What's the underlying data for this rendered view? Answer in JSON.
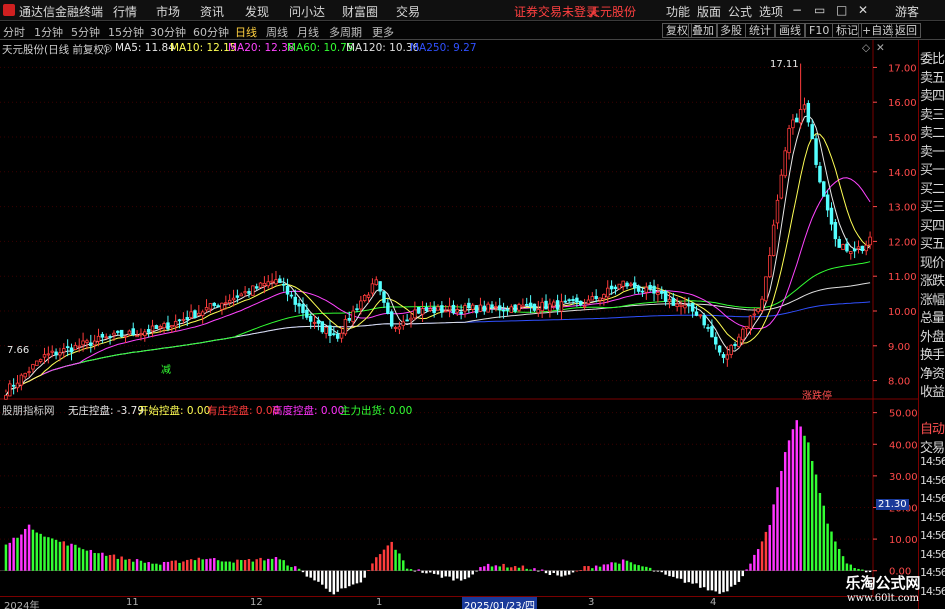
{
  "menubar": {
    "app_title": "通达信金融终端",
    "items": [
      "行情",
      "市场",
      "资讯",
      "发现",
      "问小达",
      "财富圈",
      "交易"
    ],
    "status": "证券交易未登录",
    "stock": "天元股份",
    "right_items": [
      "功能",
      "版面",
      "公式",
      "选项"
    ],
    "guest": "游客"
  },
  "periodbar": {
    "periods": [
      "分时",
      "1分钟",
      "5分钟",
      "15分钟",
      "30分钟",
      "60分钟",
      "日线",
      "周线",
      "月线",
      "多周期",
      "更多"
    ],
    "active": "日线",
    "tools": [
      "复权",
      "叠加",
      "多股",
      "统计",
      "画线",
      "F10",
      "标记",
      "+自选",
      "返回"
    ]
  },
  "main_legend": {
    "title": "天元股份(日线 前复权)",
    "ma5": "MA5: 11.84",
    "ma10": "MA10: 12.15",
    "ma20": "MA20: 12.38",
    "ma60": "MA60: 10.75",
    "ma120": "MA120: 10.36",
    "ma250": "MA250: 9.27"
  },
  "sub_legend": {
    "title": "股朋指标网",
    "wzkp": "无庄控盘: -3.79",
    "kskp": "开始控盘: 0.00",
    "yzkp": "有庄控盘: 0.00",
    "gdkp": "高度控盘: 0.00",
    "zlch": "主力出货: 0.00"
  },
  "annotations": {
    "high_label": "17.11",
    "low_label": "7.66",
    "reduce_mark": "减",
    "limit_mark": "涨跌停"
  },
  "sidepanel": [
    "委比",
    "卖五",
    "卖四",
    "卖三",
    "卖二",
    "卖一",
    "买一",
    "买二",
    "买三",
    "买四",
    "买五",
    "现价",
    "涨跌",
    "涨幅",
    "总量",
    "外盘",
    "换手",
    "净资",
    "收益",
    "",
    "自动",
    "交易",
    "14:56",
    "14:56",
    "14:56",
    "14:56",
    "14:56",
    "14:56",
    "14:56",
    "14:56"
  ],
  "dates": {
    "labels": [
      "2024年",
      "11",
      "12",
      "1",
      "3",
      "4"
    ],
    "cursor": "2025/01/23/四"
  },
  "watermark": {
    "big": "乐淘公式网",
    "small": "www.60lt.com"
  },
  "colors": {
    "up": "#ff3c3c",
    "down": "#54ffff",
    "ma5": "#e8e8e8",
    "ma10": "#ffff55",
    "ma20": "#ff44ff",
    "ma60": "#33ff33",
    "ma120": "#e0e0e0",
    "ma250": "#3050ff",
    "magenta": "#ff33ff",
    "green": "#33ff33"
  },
  "chart_data": [
    {
      "type": "candlestick",
      "title": "天元股份(日线 前复权)",
      "y_ticks": [
        8.0,
        9.0,
        10.0,
        11.0,
        12.0,
        13.0,
        14.0,
        15.0,
        16.0,
        17.0
      ],
      "ylim": [
        7.5,
        17.5
      ],
      "anchors": [
        {
          "i": 0,
          "v": 7.7
        },
        {
          "i": 10,
          "v": 8.7
        },
        {
          "i": 25,
          "v": 9.2
        },
        {
          "i": 40,
          "v": 9.5
        },
        {
          "i": 55,
          "v": 10.2
        },
        {
          "i": 70,
          "v": 10.9
        },
        {
          "i": 80,
          "v": 9.6
        },
        {
          "i": 86,
          "v": 9.3
        },
        {
          "i": 92,
          "v": 10.3
        },
        {
          "i": 96,
          "v": 10.8
        },
        {
          "i": 100,
          "v": 9.5
        },
        {
          "i": 106,
          "v": 10.0
        },
        {
          "i": 130,
          "v": 10.1
        },
        {
          "i": 150,
          "v": 10.2
        },
        {
          "i": 160,
          "v": 10.8
        },
        {
          "i": 170,
          "v": 10.4
        },
        {
          "i": 180,
          "v": 9.9
        },
        {
          "i": 186,
          "v": 8.6
        },
        {
          "i": 190,
          "v": 9.3
        },
        {
          "i": 196,
          "v": 10.3
        },
        {
          "i": 203,
          "v": 15.2
        },
        {
          "i": 207,
          "v": 15.9
        },
        {
          "i": 211,
          "v": 13.8
        },
        {
          "i": 216,
          "v": 11.8
        },
        {
          "i": 222,
          "v": 11.8
        },
        {
          "i": 224,
          "v": 12.0
        }
      ],
      "high": 17.11,
      "low": 7.66,
      "count": 225,
      "ma_final": {
        "MA5": 11.84,
        "MA10": 12.15,
        "MA20": 12.38,
        "MA60": 10.75,
        "MA120": 10.36,
        "MA250": 9.27
      }
    },
    {
      "type": "bar",
      "title": "股朋指标网",
      "y_ticks": [
        0.0,
        10.0,
        20.0,
        30.0,
        40.0,
        50.0
      ],
      "ylim": [
        -8,
        54
      ],
      "current_label": "21.30",
      "anchors": [
        {
          "i": 0,
          "v": 8
        },
        {
          "i": 6,
          "v": 14
        },
        {
          "i": 12,
          "v": 10
        },
        {
          "i": 20,
          "v": 7
        },
        {
          "i": 30,
          "v": 4
        },
        {
          "i": 40,
          "v": 2
        },
        {
          "i": 50,
          "v": 4
        },
        {
          "i": 60,
          "v": 3
        },
        {
          "i": 70,
          "v": 4
        },
        {
          "i": 75,
          "v": 1
        },
        {
          "i": 80,
          "v": -3
        },
        {
          "i": 85,
          "v": -7
        },
        {
          "i": 92,
          "v": -4
        },
        {
          "i": 96,
          "v": 4
        },
        {
          "i": 100,
          "v": 9
        },
        {
          "i": 104,
          "v": 1
        },
        {
          "i": 110,
          "v": -1
        },
        {
          "i": 118,
          "v": -3
        },
        {
          "i": 125,
          "v": 2
        },
        {
          "i": 135,
          "v": 1
        },
        {
          "i": 145,
          "v": -2
        },
        {
          "i": 150,
          "v": 1
        },
        {
          "i": 160,
          "v": 3
        },
        {
          "i": 166,
          "v": 1
        },
        {
          "i": 172,
          "v": -2
        },
        {
          "i": 178,
          "v": -4
        },
        {
          "i": 182,
          "v": -6
        },
        {
          "i": 186,
          "v": -7
        },
        {
          "i": 190,
          "v": -3
        },
        {
          "i": 193,
          "v": 2
        },
        {
          "i": 198,
          "v": 15
        },
        {
          "i": 202,
          "v": 37
        },
        {
          "i": 205,
          "v": 48
        },
        {
          "i": 208,
          "v": 40
        },
        {
          "i": 213,
          "v": 15
        },
        {
          "i": 218,
          "v": 2
        },
        {
          "i": 224,
          "v": -1
        }
      ],
      "count": 225
    }
  ]
}
